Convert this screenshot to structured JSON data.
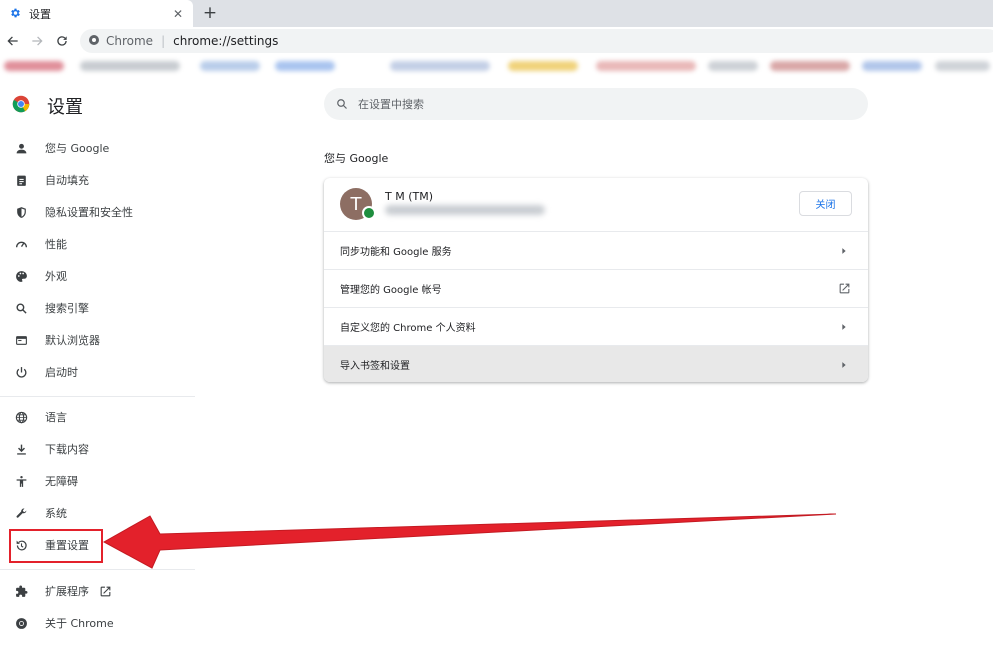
{
  "browser": {
    "tab_title": "设置",
    "omnibox_site": "Chrome",
    "omnibox_url": "chrome://settings"
  },
  "settings": {
    "title": "设置",
    "search_placeholder": "在设置中搜索",
    "nav": [
      {
        "label": "您与 Google",
        "icon": "person-icon"
      },
      {
        "label": "自动填充",
        "icon": "clipboard-icon"
      },
      {
        "label": "隐私设置和安全性",
        "icon": "shield-icon"
      },
      {
        "label": "性能",
        "icon": "speedometer-icon"
      },
      {
        "label": "外观",
        "icon": "palette-icon"
      },
      {
        "label": "搜索引擎",
        "icon": "search-icon"
      },
      {
        "label": "默认浏览器",
        "icon": "browser-icon"
      },
      {
        "label": "启动时",
        "icon": "power-icon"
      },
      {
        "label": "语言",
        "icon": "globe-icon"
      },
      {
        "label": "下载内容",
        "icon": "download-icon"
      },
      {
        "label": "无障碍",
        "icon": "accessibility-icon"
      },
      {
        "label": "系统",
        "icon": "wrench-icon"
      },
      {
        "label": "重置设置",
        "icon": "reset-icon"
      },
      {
        "label": "扩展程序",
        "icon": "puzzle-icon"
      },
      {
        "label": "关于 Chrome",
        "icon": "chrome-icon"
      }
    ],
    "section_title": "您与 Google",
    "profile": {
      "avatar_letter": "T",
      "name": "T M (TM)",
      "close_label": "关闭"
    },
    "rows": [
      {
        "label": "同步功能和 Google 服务",
        "icon": "chevron-right-icon"
      },
      {
        "label": "管理您的 Google 帐号",
        "icon": "open-in-new-icon"
      },
      {
        "label": "自定义您的 Chrome 个人资料",
        "icon": "chevron-right-icon"
      },
      {
        "label": "导入书签和设置",
        "icon": "chevron-right-icon"
      }
    ]
  },
  "colors": {
    "highlight": "#e3212b",
    "accent": "#1a73e8"
  }
}
